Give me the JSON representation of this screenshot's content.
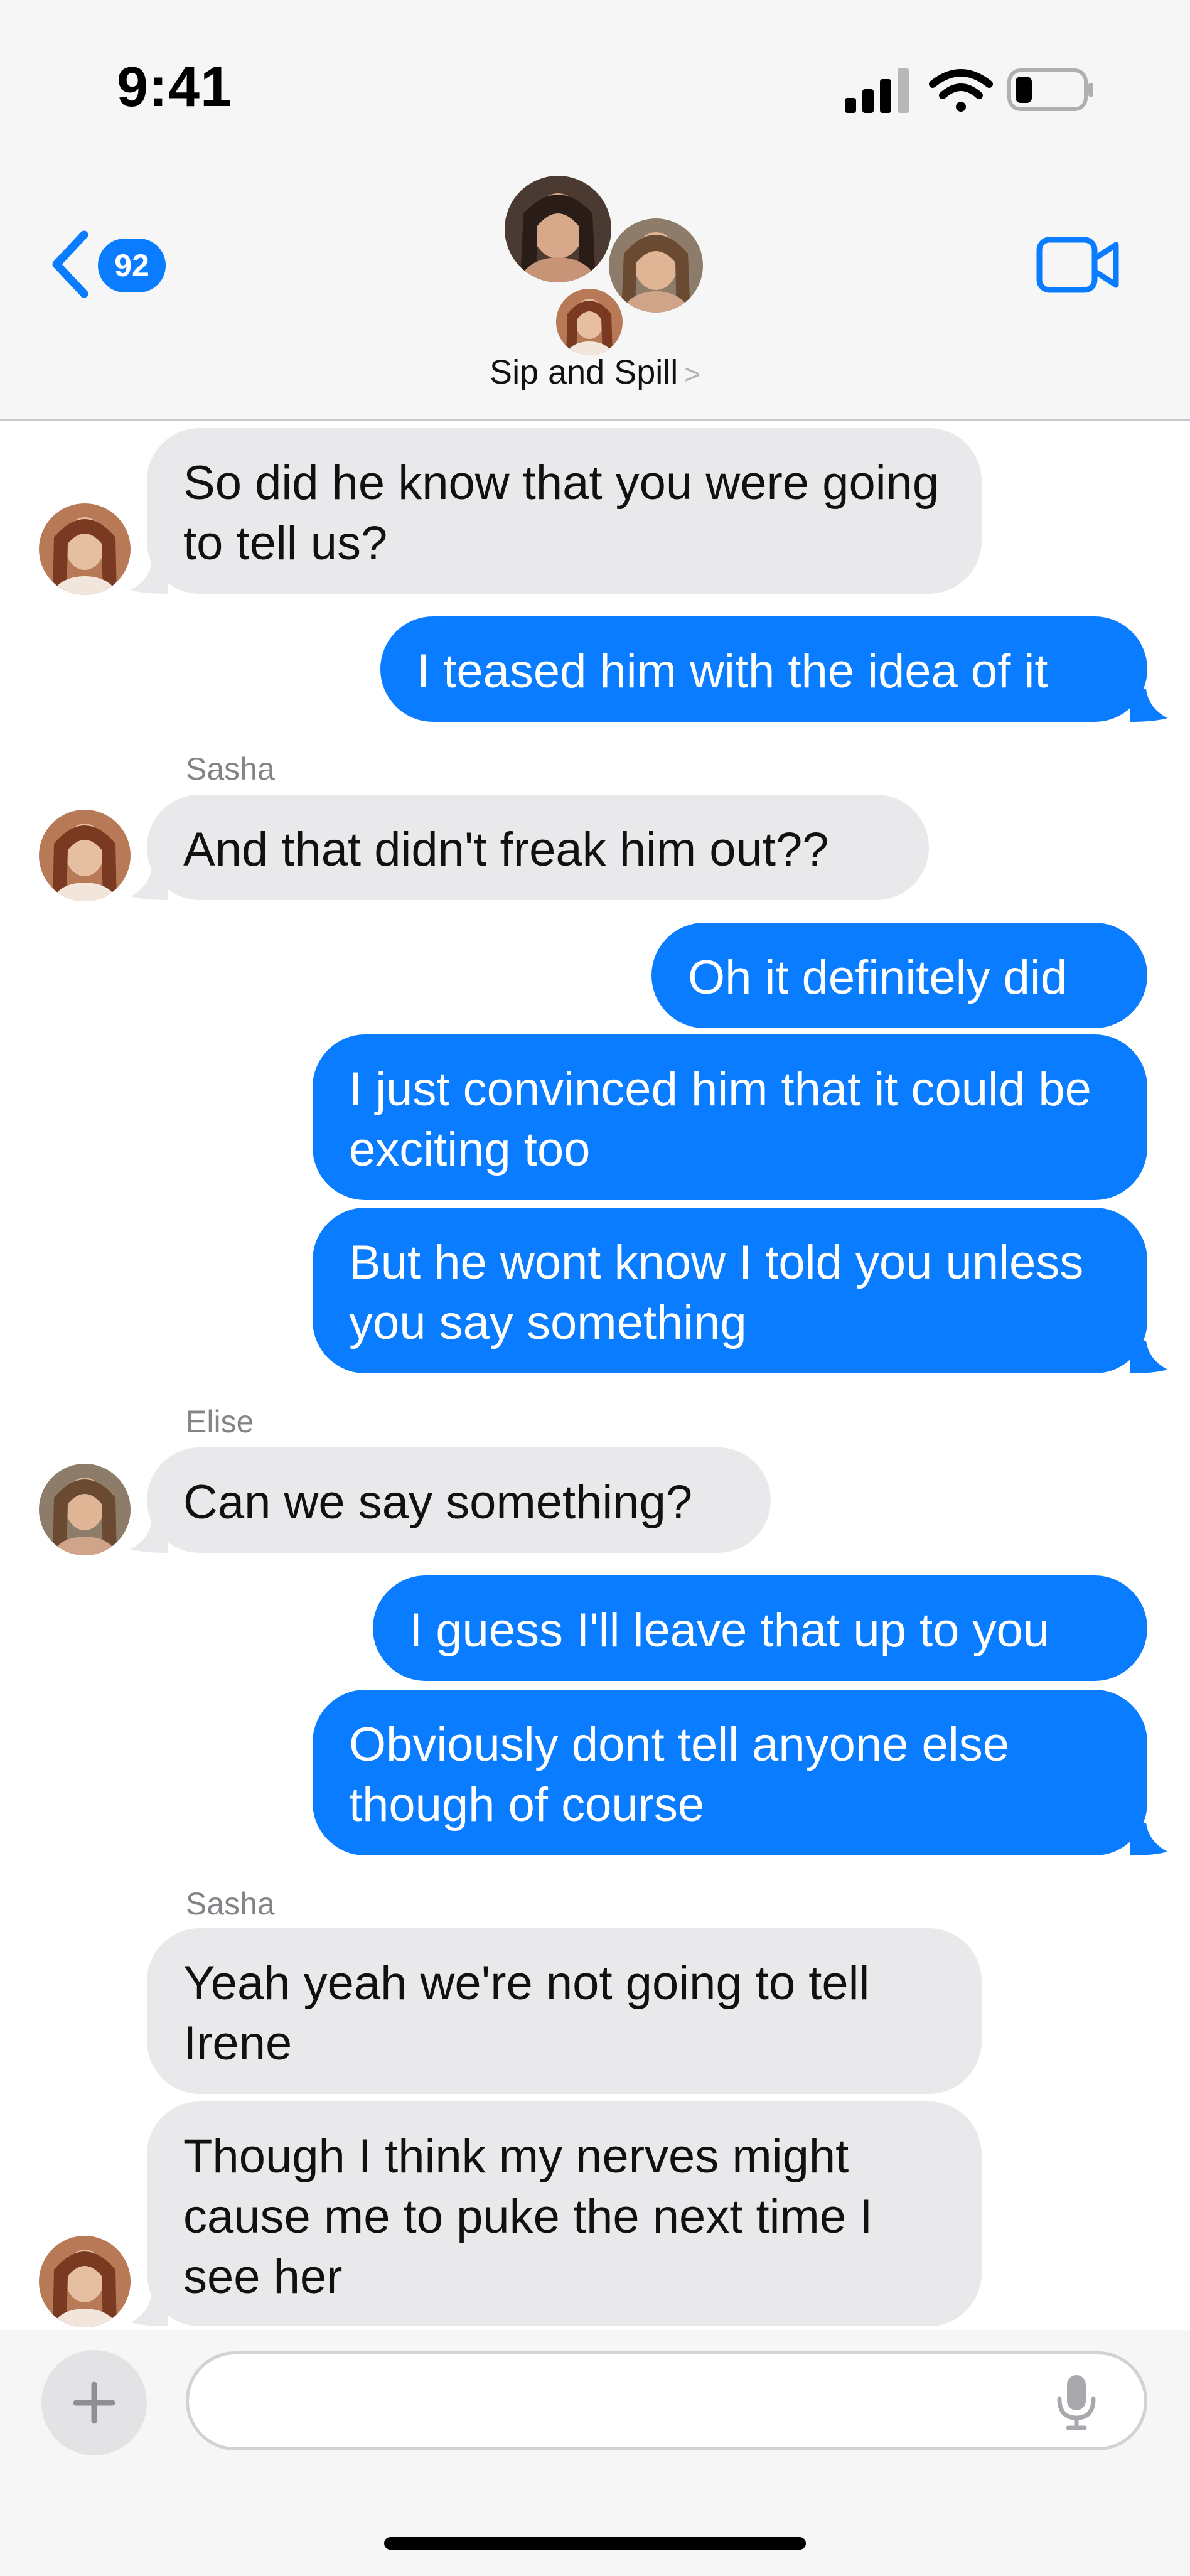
{
  "status": {
    "time": "9:41"
  },
  "header": {
    "back_count": "92",
    "group_name": "Sip and Spill",
    "group_chevron": ">"
  },
  "messages": [
    {
      "side": "in",
      "text": "So did he know that you were going to tell us?"
    },
    {
      "side": "out",
      "text": "I teased him with the idea of it"
    },
    {
      "side": "in",
      "sender": "Sasha",
      "text": "And that didn't freak him out??"
    },
    {
      "side": "out",
      "text": "Oh it definitely did"
    },
    {
      "side": "out",
      "text": "I just convinced him that it could be exciting too"
    },
    {
      "side": "out",
      "text": "But he wont know I told you unless you say something"
    },
    {
      "side": "in",
      "sender": "Elise",
      "text": "Can we say something?"
    },
    {
      "side": "out",
      "text": "I guess I'll leave that up to you"
    },
    {
      "side": "out",
      "text": "Obviously dont tell anyone else though of course"
    },
    {
      "side": "in",
      "sender": "Sasha",
      "text": "Yeah yeah we're not going to tell Irene"
    },
    {
      "side": "in",
      "text": "Though I think my nerves might cause me to puke the next time I see her"
    }
  ],
  "composer": {
    "placeholder": ""
  },
  "colors": {
    "accent": "#0a7cff",
    "incoming_bubble": "#e9e9eb",
    "header_bg": "#f6f6f6"
  },
  "icons": [
    "signal-icon",
    "wifi-icon",
    "battery-icon",
    "back-chevron-icon",
    "video-call-icon",
    "plus-icon",
    "microphone-icon"
  ]
}
